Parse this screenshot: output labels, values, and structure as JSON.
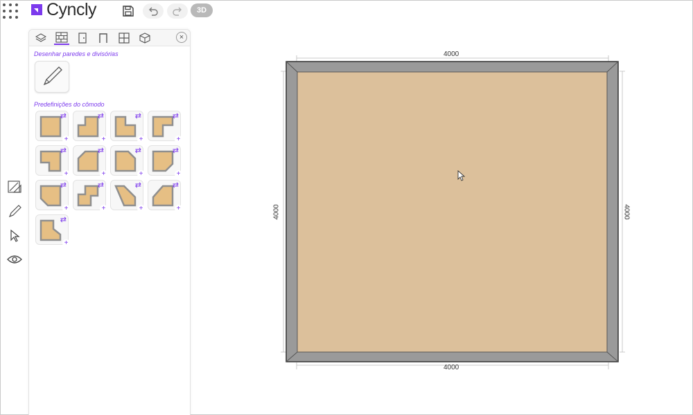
{
  "app": {
    "brand": "Cyncly",
    "view_toggle_label": "3D",
    "accent_color": "#7c3aed"
  },
  "toolbar": {
    "icons": [
      "grid-menu-icon",
      "save-icon",
      "undo-icon",
      "redo-icon"
    ]
  },
  "side_tools": [
    "measure-icon",
    "pencil-icon",
    "pointer-icon",
    "eye-icon"
  ],
  "panel": {
    "tabs": [
      "layers-icon",
      "walls-icon",
      "door-icon",
      "arch-icon",
      "window-icon",
      "cube-icon"
    ],
    "active_tab": "walls-icon",
    "draw_section_title": "Desenhar paredes e divisórias",
    "presets_section_title": "Predefinições do cômodo",
    "preset_count": 13
  },
  "room": {
    "top_dimension": "4000",
    "bottom_dimension": "4000",
    "left_dimension": "4000",
    "right_dimension": "4000",
    "floor_color": "#dcc09b",
    "wall_color": "#9a9a9a"
  }
}
